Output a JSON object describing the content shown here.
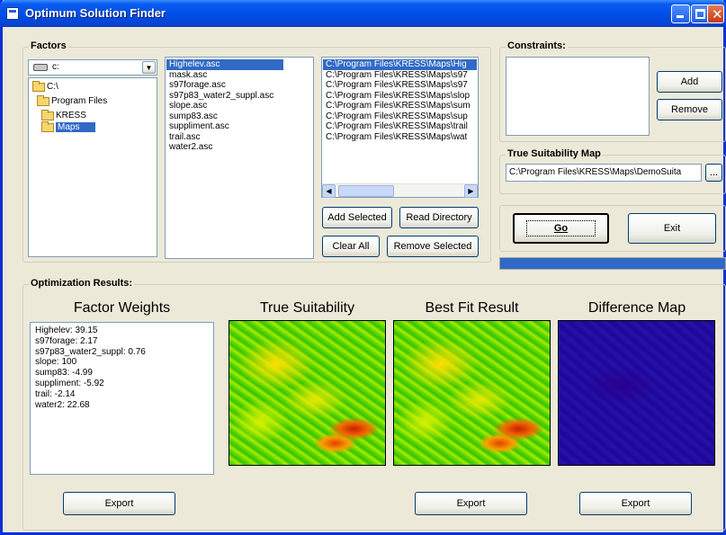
{
  "window": {
    "title": "Optimum Solution Finder"
  },
  "factors": {
    "group_label": "Factors",
    "drive": "c:",
    "tree": [
      "C:\\",
      "Program Files",
      "KRESS",
      "Maps"
    ],
    "files": [
      "Highelev.asc",
      "mask.asc",
      "s97forage.asc",
      "s97p83_water2_suppl.asc",
      "slope.asc",
      "sump83.asc",
      "suppliment.asc",
      "trail.asc",
      "water2.asc"
    ],
    "selected": [
      "C:\\Program Files\\KRESS\\Maps\\Hig",
      "C:\\Program Files\\KRESS\\Maps\\s97",
      "C:\\Program Files\\KRESS\\Maps\\s97",
      "C:\\Program Files\\KRESS\\Maps\\slop",
      "C:\\Program Files\\KRESS\\Maps\\sum",
      "C:\\Program Files\\KRESS\\Maps\\sup",
      "C:\\Program Files\\KRESS\\Maps\\trail",
      "C:\\Program Files\\KRESS\\Maps\\wat"
    ],
    "buttons": {
      "add_selected": "Add Selected",
      "read_directory": "Read Directory",
      "clear_all": "Clear All",
      "remove_selected": "Remove Selected"
    }
  },
  "constraints": {
    "group_label": "Constraints:",
    "add": "Add",
    "remove": "Remove"
  },
  "true_suitability_map": {
    "group_label": "True Suitability Map",
    "path": "C:\\Program Files\\KRESS\\Maps\\DemoSuita",
    "browse": "..."
  },
  "actions": {
    "go": "Go",
    "exit": "Exit",
    "progress": 1.0
  },
  "results": {
    "group_label": "Optimization Results:",
    "factor_weights_title": "Factor Weights",
    "weights": [
      "Highelev: 39.15",
      "s97forage: 2.17",
      "s97p83_water2_suppl: 0.76",
      "slope: 100",
      "sump83: -4.99",
      "suppliment: -5.92",
      "trail: -2.14",
      "water2: 22.68"
    ],
    "true_suitability_title": "True Suitability",
    "best_fit_title": "Best Fit Result",
    "difference_title": "Difference Map",
    "export": "Export"
  },
  "colors": {
    "titlebar": "#0050E8",
    "selection": "#316AC5",
    "progress": "#3169C6"
  }
}
